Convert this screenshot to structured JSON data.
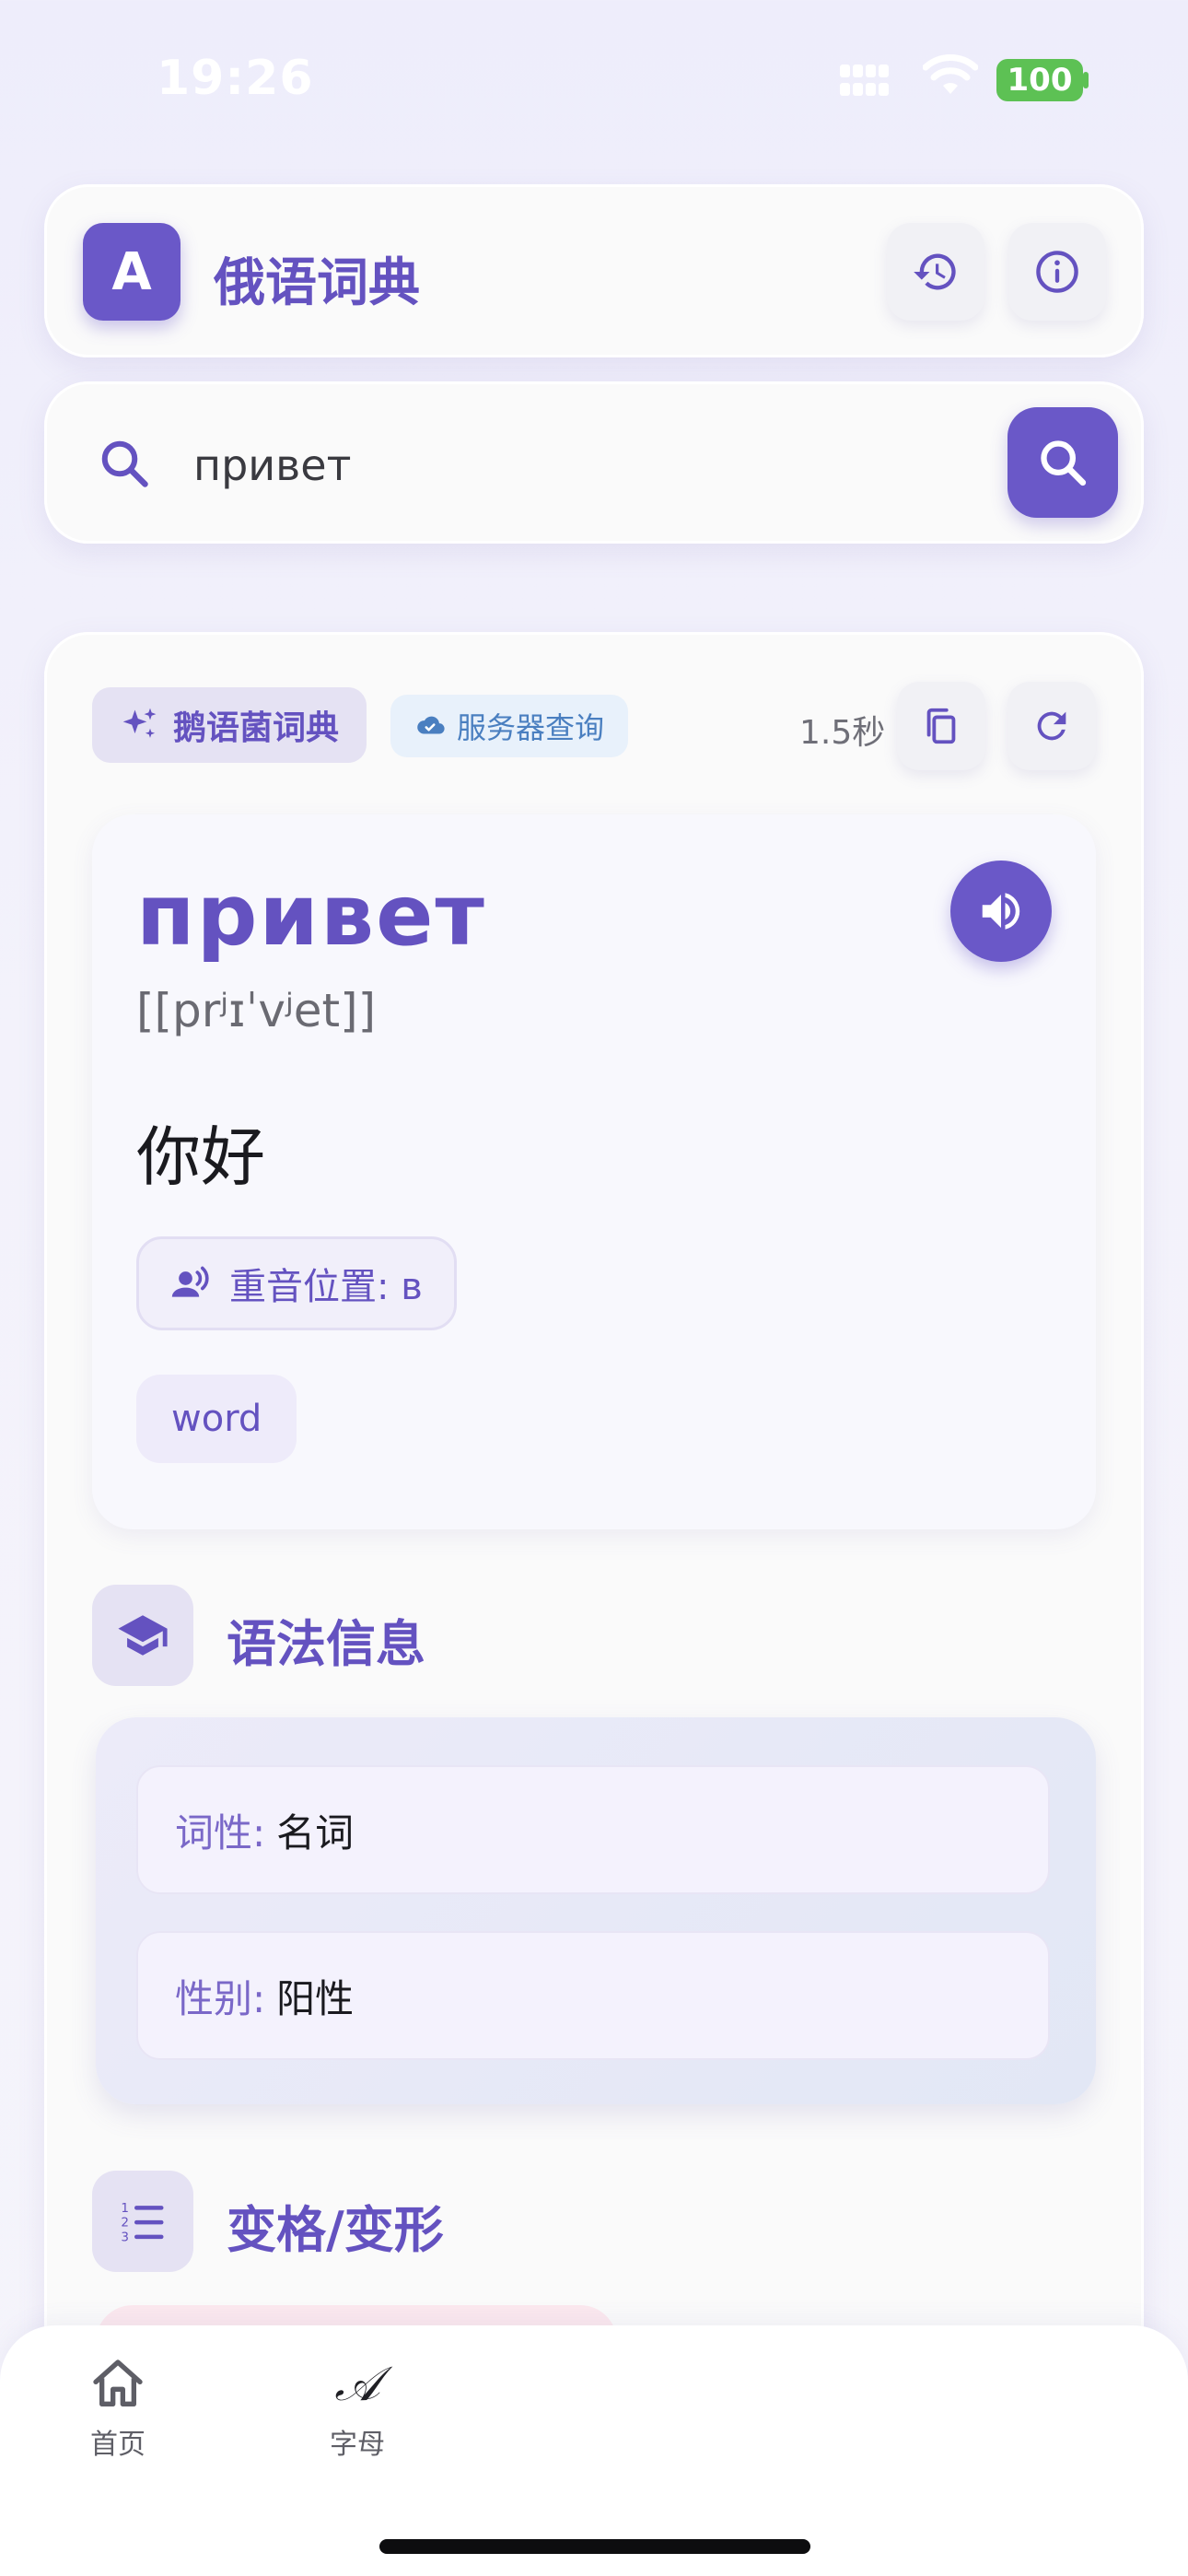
{
  "status_bar": {
    "time": "19:26",
    "battery": "100",
    "icons": [
      "signal-icon",
      "wifi-icon",
      "battery-icon"
    ]
  },
  "header": {
    "logo_letter": "A",
    "title": "俄语词典",
    "icons": [
      "history-icon",
      "info-icon"
    ]
  },
  "search": {
    "value": "привет",
    "placeholder": "",
    "icons": [
      "search-icon"
    ]
  },
  "result": {
    "source_label": "鹅语菌词典",
    "mode_label": "服务器查询",
    "elapsed": "1.5秒",
    "icons": [
      "sparkle-icon",
      "cloud-check-icon",
      "copy-icon",
      "refresh-icon"
    ]
  },
  "word": {
    "text": "привет",
    "transcription": "[[prʲɪˈvʲet]]",
    "translation": "你好",
    "stress_label": "重音位置: в",
    "tag": "word",
    "icons": [
      "speaker-icon",
      "voice-person-icon"
    ]
  },
  "grammar": {
    "title": "语法信息",
    "rows": [
      {
        "key": "词性:",
        "value": "名词"
      },
      {
        "key": "性别:",
        "value": "阳性"
      }
    ],
    "icon": "graduation-cap-icon"
  },
  "declension": {
    "title": "变格/变形",
    "icon": "numbered-list-icon"
  },
  "nav": {
    "items": [
      {
        "label": "首页",
        "icon": "home-icon"
      },
      {
        "label": "字母",
        "icon": "script-a-icon",
        "glyph": "𝒜"
      }
    ]
  },
  "colors": {
    "accent": "#6a58c8",
    "accent_text": "#6452c0",
    "battery": "#5dc154",
    "server_chip": "#4a7fc0"
  }
}
